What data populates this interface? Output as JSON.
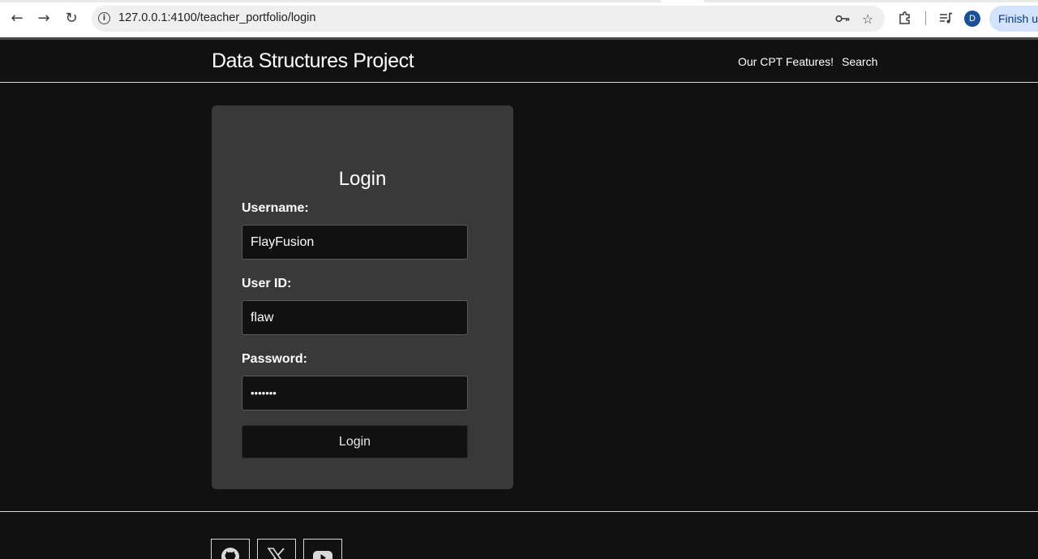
{
  "browser": {
    "url": "127.0.0.1:4100/teacher_portfolio/login",
    "avatar_letter": "D",
    "finish_button": "Finish up",
    "icons": [
      "back-arrow-icon",
      "forward-arrow-icon",
      "reload-icon",
      "site-info-icon",
      "password-key-icon",
      "bookmark-star-icon",
      "extensions-puzzle-icon",
      "reading-list-icon"
    ]
  },
  "header": {
    "title": "Data Structures Project",
    "nav": [
      {
        "label": "Our CPT Features!"
      },
      {
        "label": "Search"
      }
    ]
  },
  "login": {
    "title": "Login",
    "username_label": "Username:",
    "username_value": "FlayFusion",
    "userid_label": "User ID:",
    "userid_value": "flaw",
    "password_label": "Password:",
    "password_value": "•••••••",
    "submit_label": "Login"
  },
  "footer": {
    "social": [
      "github-icon",
      "x-twitter-icon",
      "youtube-icon"
    ]
  },
  "colors": {
    "page_bg": "#111111",
    "card_bg": "#393939",
    "text": "#ffffff",
    "chrome_accent": "#d3e3fd"
  }
}
